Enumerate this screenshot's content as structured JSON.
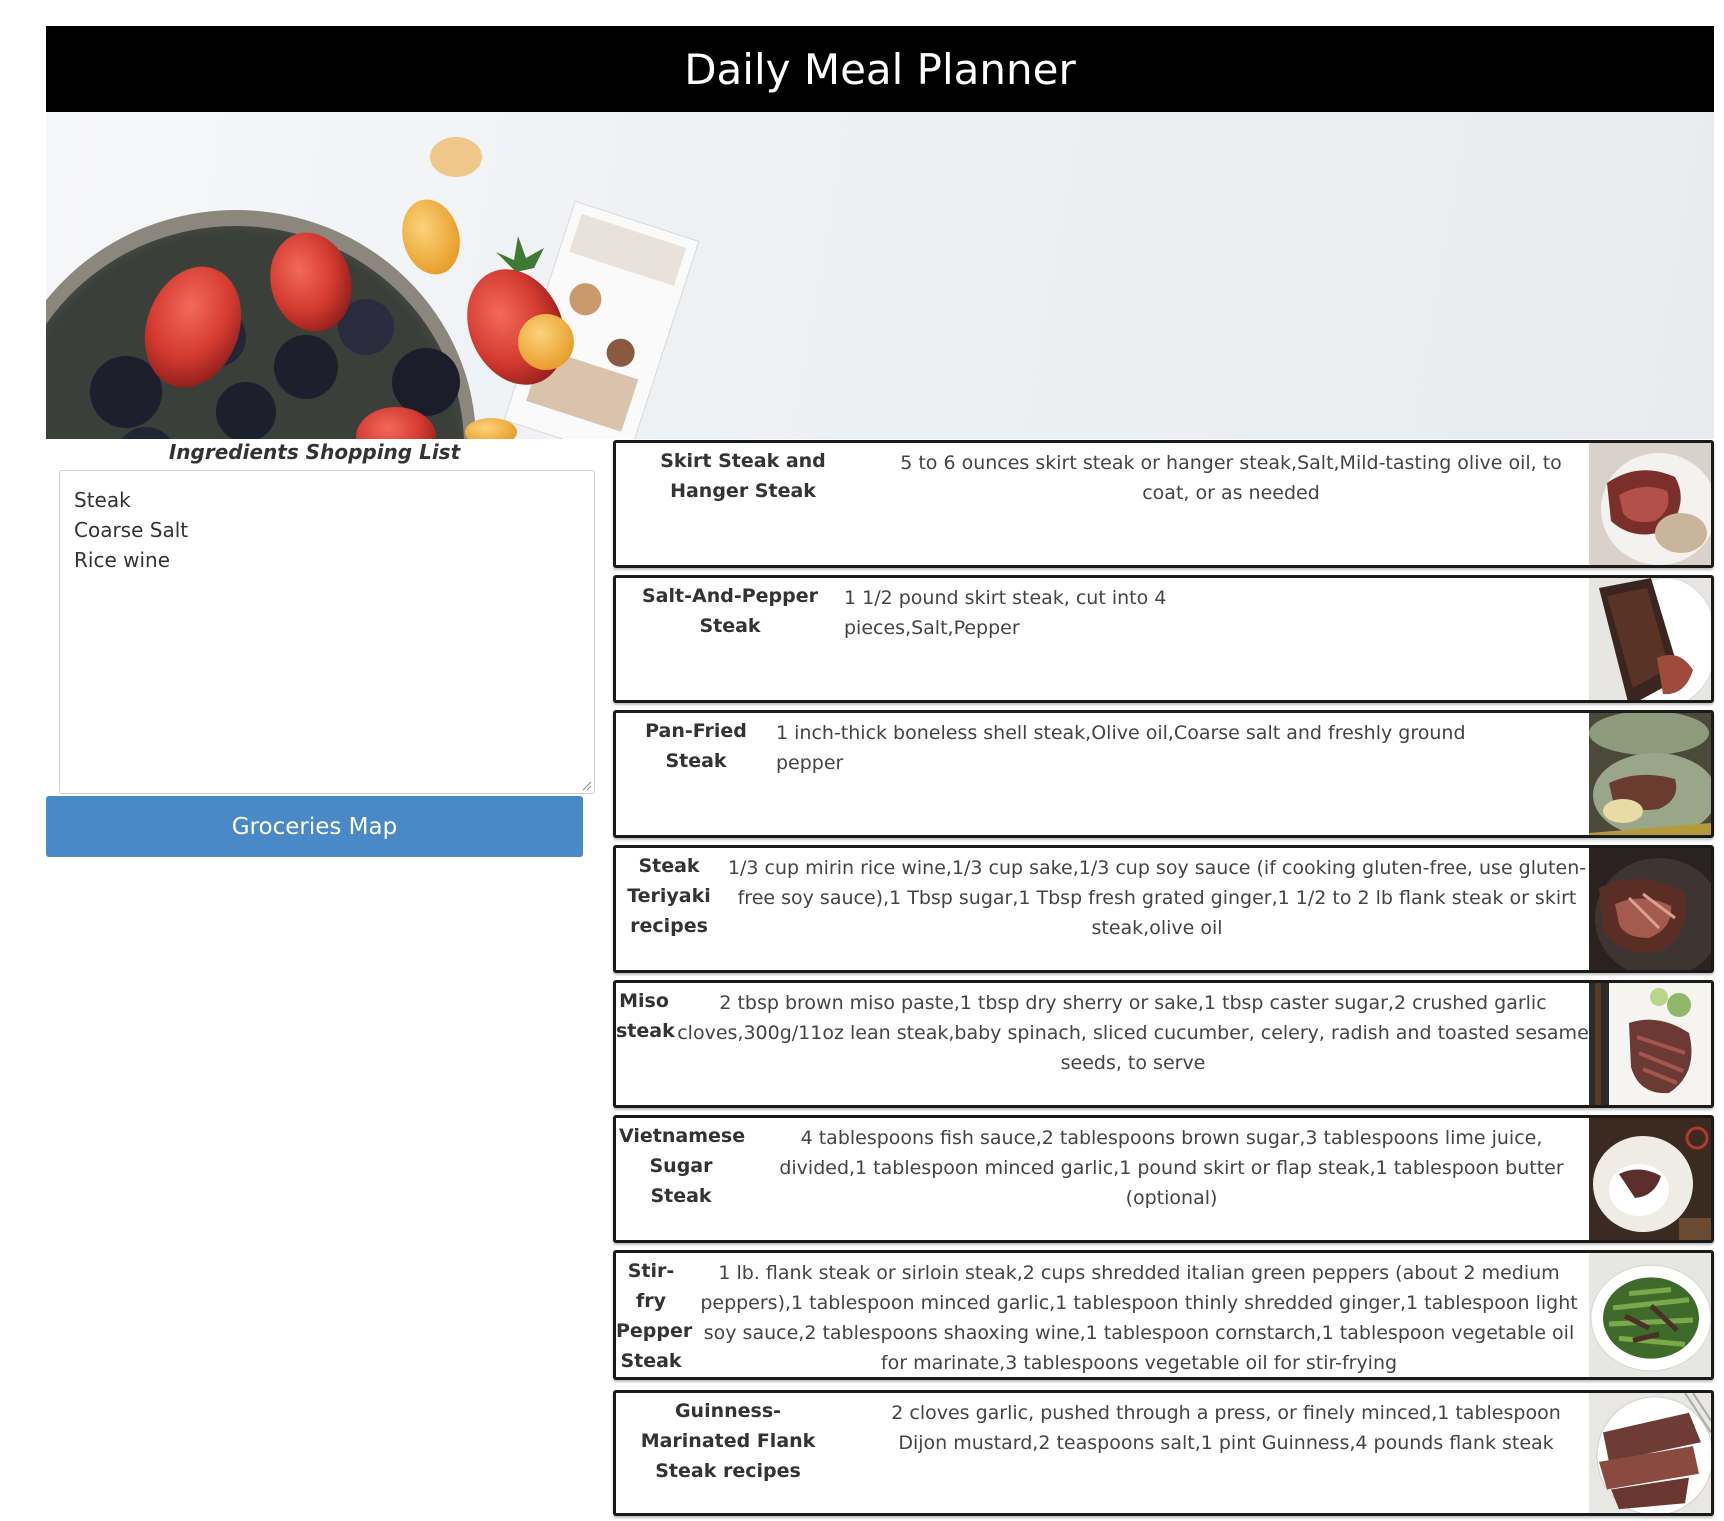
{
  "header": {
    "title": "Daily Meal Planner"
  },
  "shopping_list": {
    "title": "Ingredients Shopping List",
    "items": [
      "Steak",
      "Coarse Salt",
      "Rice wine"
    ]
  },
  "groceries_button": {
    "label": "Groceries Map"
  },
  "recipes": [
    {
      "name": "Skirt Steak and Hanger Steak",
      "ingredients": "5 to 6 ounces skirt steak or hanger steak,Salt,Mild-tasting olive oil, to coat, or as needed",
      "photo": "steak-photo"
    },
    {
      "name": "Salt-And-Pepper Steak",
      "ingredients": "1 1/2 pound skirt steak, cut into 4 pieces,Salt,Pepper",
      "photo": "steak-photo"
    },
    {
      "name": "Pan-Fried Steak",
      "ingredients": "1 inch-thick boneless shell steak,Olive oil,Coarse salt and freshly ground pepper",
      "photo": "steak-photo"
    },
    {
      "name": "Steak Teriyaki recipes",
      "ingredients": "1/3 cup mirin rice wine,1/3 cup sake,1/3 cup soy sauce (if cooking gluten-free, use gluten-free soy sauce),1 Tbsp sugar,1 Tbsp fresh grated ginger,1 1/2 to 2 lb flank steak or skirt steak,olive oil",
      "photo": "steak-photo"
    },
    {
      "name": "Miso steak",
      "ingredients": "2 tbsp brown miso paste,1 tbsp dry sherry or sake,1 tbsp caster sugar,2 crushed garlic cloves,300g/11oz lean steak,baby spinach, sliced cucumber, celery, radish and toasted sesame seeds, to serve",
      "photo": "steak-photo"
    },
    {
      "name": "Vietnamese Sugar Steak",
      "ingredients": "4 tablespoons fish sauce,2 tablespoons brown sugar,3 tablespoons lime juice, divided,1 tablespoon minced garlic,1 pound skirt or flap steak,1 tablespoon butter (optional)",
      "photo": "steak-photo"
    },
    {
      "name": "Stir-fry Pepper Steak",
      "ingredients": "1 lb. flank steak or sirloin steak,2 cups shredded italian green peppers (about 2 medium peppers),1 tablespoon minced garlic,1 tablespoon thinly shredded ginger,1 tablespoon light soy sauce,2 tablespoons shaoxing wine,1 tablespoon cornstarch,1 tablespoon vegetable oil for marinate,3 tablespoons vegetable oil for stir-frying",
      "photo": "pepper-steak-photo"
    },
    {
      "name": "Guinness-Marinated Flank Steak recipes",
      "ingredients": "2 cloves garlic, pushed through a press, or finely minced,1 tablespoon Dijon mustard,2 teaspoons salt,1 pint Guinness,4 pounds flank steak",
      "photo": "steak-photo"
    }
  ],
  "colors": {
    "header_bg": "#000000",
    "button_bg": "#4a89c8",
    "card_border": "#1a1a1a"
  }
}
